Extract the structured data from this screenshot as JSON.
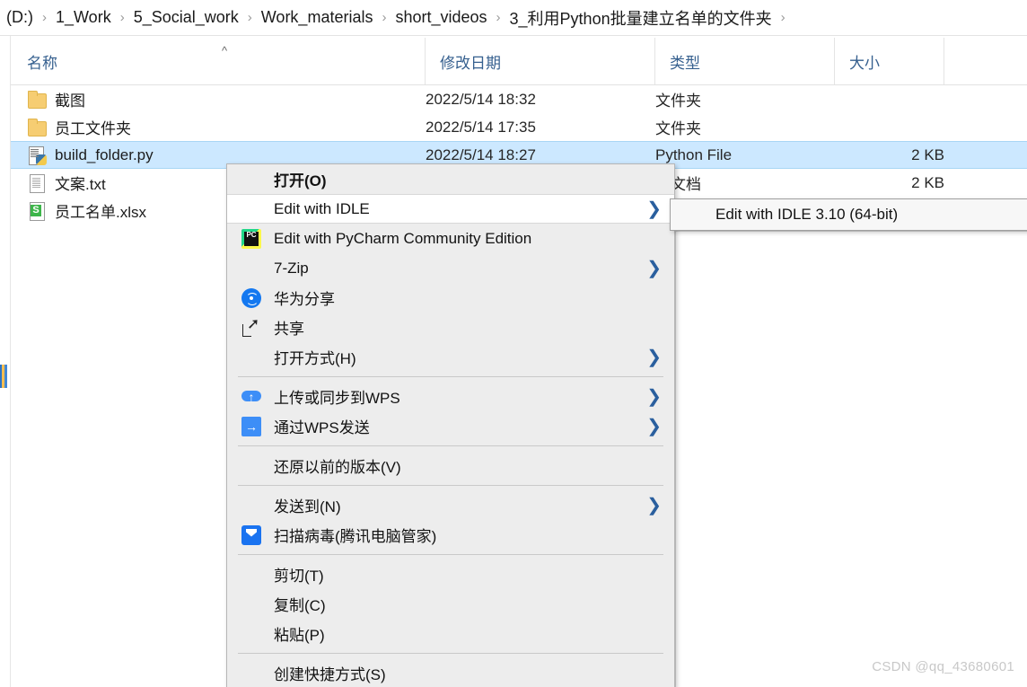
{
  "breadcrumb": {
    "separator": "›",
    "items": [
      {
        "label": "(D:)"
      },
      {
        "label": "1_Work"
      },
      {
        "label": "5_Social_work"
      },
      {
        "label": "Work_materials"
      },
      {
        "label": "short_videos"
      },
      {
        "label": "3_利用Python批量建立名单的文件夹"
      }
    ]
  },
  "columns": [
    {
      "label": "名称",
      "sort_indicator": "^"
    },
    {
      "label": "修改日期"
    },
    {
      "label": "类型"
    },
    {
      "label": "大小"
    }
  ],
  "files": [
    {
      "name": "截图",
      "icon": "folder-icon",
      "date": "2022/5/14 18:32",
      "type": "文件夹",
      "size": ""
    },
    {
      "name": "员工文件夹",
      "icon": "folder-icon",
      "date": "2022/5/14 17:35",
      "type": "文件夹",
      "size": ""
    },
    {
      "name": "build_folder.py",
      "icon": "python-file-icon",
      "date": "2022/5/14 18:27",
      "type": "Python File",
      "size": "2 KB",
      "selected": true
    },
    {
      "name": "文案.txt",
      "icon": "text-file-icon",
      "date": "",
      "type": "本文档",
      "size": "2 KB"
    },
    {
      "name": "员工名单.xlsx",
      "icon": "excel-file-icon",
      "date": "",
      "type": "",
      "size": ""
    }
  ],
  "context_menu": {
    "items": [
      {
        "label": "打开(O)",
        "bold": true,
        "icon": "",
        "arrow": false
      },
      {
        "label": "Edit with IDLE",
        "icon": "",
        "arrow": true,
        "hover": true
      },
      {
        "label": "Edit with PyCharm Community Edition",
        "icon": "pycharm-icon",
        "arrow": false
      },
      {
        "label": "7-Zip",
        "icon": "",
        "arrow": true
      },
      {
        "label": "华为分享",
        "icon": "huawei-share-icon",
        "arrow": false
      },
      {
        "label": "共享",
        "icon": "share-icon",
        "arrow": false
      },
      {
        "label": "打开方式(H)",
        "icon": "",
        "arrow": true
      },
      {
        "separator": true
      },
      {
        "label": "上传或同步到WPS",
        "icon": "wps-upload-icon",
        "arrow": true
      },
      {
        "label": "通过WPS发送",
        "icon": "wps-send-icon",
        "arrow": true
      },
      {
        "separator": true
      },
      {
        "label": "还原以前的版本(V)",
        "icon": "",
        "arrow": false
      },
      {
        "separator": true
      },
      {
        "label": "发送到(N)",
        "icon": "",
        "arrow": true
      },
      {
        "label": "扫描病毒(腾讯电脑管家)",
        "icon": "scan-virus-icon",
        "arrow": false
      },
      {
        "separator": true
      },
      {
        "label": "剪切(T)",
        "icon": "",
        "arrow": false
      },
      {
        "label": "复制(C)",
        "icon": "",
        "arrow": false
      },
      {
        "label": "粘贴(P)",
        "icon": "",
        "arrow": false
      },
      {
        "separator": true
      },
      {
        "label": "创建快捷方式(S)",
        "icon": "",
        "arrow": false
      }
    ]
  },
  "submenu": {
    "items": [
      {
        "label": "Edit with IDLE 3.10 (64-bit)"
      }
    ]
  },
  "watermark": {
    "text": "CSDN @qq_43680601"
  },
  "colors": {
    "selection": "#cce8ff",
    "menu_background": "#ededed",
    "menu_hover": "#ffffff",
    "header_text": "#36608f",
    "arrow": "#2a5f9e"
  }
}
